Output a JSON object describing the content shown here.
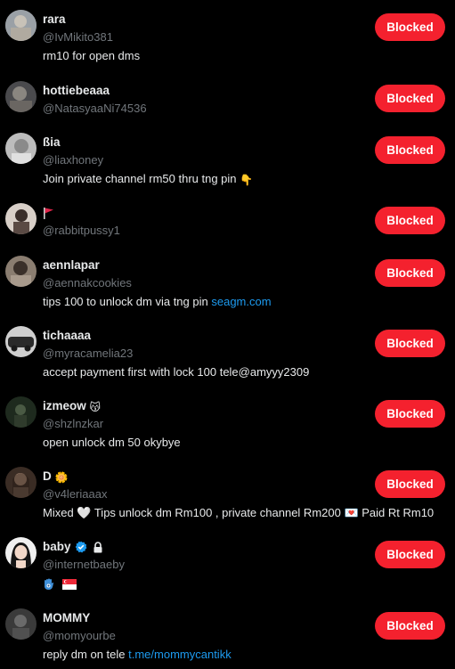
{
  "accounts": [
    {
      "name": "rara",
      "handle": "@IvMikito381",
      "bio": "rm10 for open dms",
      "button": "Blocked",
      "avatar_color": "#7a7f86"
    },
    {
      "name": "hottiebeaaa",
      "handle": "@NatasyaaNi74536",
      "bio": "",
      "button": "Blocked",
      "avatar_color": "#5d5d60"
    },
    {
      "name": "ßia",
      "handle": "@liaxhoney",
      "bio": "Join private channel rm50 thru tng pin",
      "bio_emoji": "👇",
      "button": "Blocked",
      "avatar_color": "#8a8a8a"
    },
    {
      "name": "🚩",
      "handle": "@rabbitpussy1",
      "bio": "",
      "button": "Blocked",
      "avatar_color": "#b8a8a0"
    },
    {
      "name": "aennlapar",
      "handle": "@aennakcookies",
      "bio": "tips 100 to unlock dm via tng pin",
      "bio_link": "seagm.com",
      "button": "Blocked",
      "avatar_color": "#6e6257"
    },
    {
      "name": "tichaaaa",
      "handle": "@myracamelia23",
      "bio": "accept payment first with lock 100 tele@amyyy2309",
      "button": "Blocked",
      "avatar_color": "#9a9a9a"
    },
    {
      "name": "izmeow",
      "name_emoji": "😽",
      "handle": "@shzlnzkar",
      "bio": "open unlock dm 50 okybye",
      "button": "Blocked",
      "avatar_color": "#2c3a2c"
    },
    {
      "name": "D",
      "name_emoji": "🌼",
      "handle": "@v4leriaaax",
      "bio": "Mixed 🤍 Tips unlock dm Rm100 , private channel Rm200 💌 Paid Rt Rm10",
      "button": "Blocked",
      "avatar_color": "#4a3a30"
    },
    {
      "name": "baby",
      "handle": "@internetbaeby",
      "bio": "🪬 🇸🇬",
      "button": "Blocked",
      "avatar_color": "#d8d8d8"
    },
    {
      "name": "MOMMY",
      "handle": "@momyourbe",
      "bio": "reply dm on tele",
      "bio_link": "t.me/mommycantikk",
      "button": "Blocked",
      "avatar_color": "#555555"
    }
  ],
  "colors": {
    "background": "#000000",
    "primary_text": "#e7e9ea",
    "secondary_text": "#71767b",
    "blocked_button": "#f4212e",
    "link": "#1d9bf0",
    "verified": "#1d9bf0"
  }
}
